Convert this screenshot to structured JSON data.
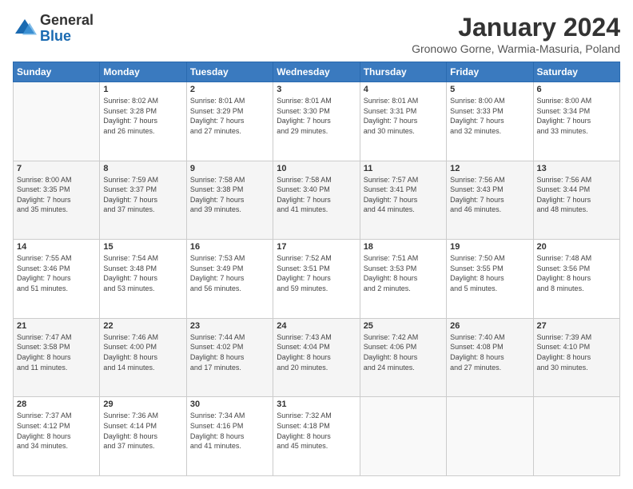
{
  "logo": {
    "general": "General",
    "blue": "Blue"
  },
  "title": "January 2024",
  "subtitle": "Gronowo Gorne, Warmia-Masuria, Poland",
  "weekdays": [
    "Sunday",
    "Monday",
    "Tuesday",
    "Wednesday",
    "Thursday",
    "Friday",
    "Saturday"
  ],
  "weeks": [
    [
      {
        "day": "",
        "info": ""
      },
      {
        "day": "1",
        "info": "Sunrise: 8:02 AM\nSunset: 3:28 PM\nDaylight: 7 hours\nand 26 minutes."
      },
      {
        "day": "2",
        "info": "Sunrise: 8:01 AM\nSunset: 3:29 PM\nDaylight: 7 hours\nand 27 minutes."
      },
      {
        "day": "3",
        "info": "Sunrise: 8:01 AM\nSunset: 3:30 PM\nDaylight: 7 hours\nand 29 minutes."
      },
      {
        "day": "4",
        "info": "Sunrise: 8:01 AM\nSunset: 3:31 PM\nDaylight: 7 hours\nand 30 minutes."
      },
      {
        "day": "5",
        "info": "Sunrise: 8:00 AM\nSunset: 3:33 PM\nDaylight: 7 hours\nand 32 minutes."
      },
      {
        "day": "6",
        "info": "Sunrise: 8:00 AM\nSunset: 3:34 PM\nDaylight: 7 hours\nand 33 minutes."
      }
    ],
    [
      {
        "day": "7",
        "info": "Sunrise: 8:00 AM\nSunset: 3:35 PM\nDaylight: 7 hours\nand 35 minutes."
      },
      {
        "day": "8",
        "info": "Sunrise: 7:59 AM\nSunset: 3:37 PM\nDaylight: 7 hours\nand 37 minutes."
      },
      {
        "day": "9",
        "info": "Sunrise: 7:58 AM\nSunset: 3:38 PM\nDaylight: 7 hours\nand 39 minutes."
      },
      {
        "day": "10",
        "info": "Sunrise: 7:58 AM\nSunset: 3:40 PM\nDaylight: 7 hours\nand 41 minutes."
      },
      {
        "day": "11",
        "info": "Sunrise: 7:57 AM\nSunset: 3:41 PM\nDaylight: 7 hours\nand 44 minutes."
      },
      {
        "day": "12",
        "info": "Sunrise: 7:56 AM\nSunset: 3:43 PM\nDaylight: 7 hours\nand 46 minutes."
      },
      {
        "day": "13",
        "info": "Sunrise: 7:56 AM\nSunset: 3:44 PM\nDaylight: 7 hours\nand 48 minutes."
      }
    ],
    [
      {
        "day": "14",
        "info": "Sunrise: 7:55 AM\nSunset: 3:46 PM\nDaylight: 7 hours\nand 51 minutes."
      },
      {
        "day": "15",
        "info": "Sunrise: 7:54 AM\nSunset: 3:48 PM\nDaylight: 7 hours\nand 53 minutes."
      },
      {
        "day": "16",
        "info": "Sunrise: 7:53 AM\nSunset: 3:49 PM\nDaylight: 7 hours\nand 56 minutes."
      },
      {
        "day": "17",
        "info": "Sunrise: 7:52 AM\nSunset: 3:51 PM\nDaylight: 7 hours\nand 59 minutes."
      },
      {
        "day": "18",
        "info": "Sunrise: 7:51 AM\nSunset: 3:53 PM\nDaylight: 8 hours\nand 2 minutes."
      },
      {
        "day": "19",
        "info": "Sunrise: 7:50 AM\nSunset: 3:55 PM\nDaylight: 8 hours\nand 5 minutes."
      },
      {
        "day": "20",
        "info": "Sunrise: 7:48 AM\nSunset: 3:56 PM\nDaylight: 8 hours\nand 8 minutes."
      }
    ],
    [
      {
        "day": "21",
        "info": "Sunrise: 7:47 AM\nSunset: 3:58 PM\nDaylight: 8 hours\nand 11 minutes."
      },
      {
        "day": "22",
        "info": "Sunrise: 7:46 AM\nSunset: 4:00 PM\nDaylight: 8 hours\nand 14 minutes."
      },
      {
        "day": "23",
        "info": "Sunrise: 7:44 AM\nSunset: 4:02 PM\nDaylight: 8 hours\nand 17 minutes."
      },
      {
        "day": "24",
        "info": "Sunrise: 7:43 AM\nSunset: 4:04 PM\nDaylight: 8 hours\nand 20 minutes."
      },
      {
        "day": "25",
        "info": "Sunrise: 7:42 AM\nSunset: 4:06 PM\nDaylight: 8 hours\nand 24 minutes."
      },
      {
        "day": "26",
        "info": "Sunrise: 7:40 AM\nSunset: 4:08 PM\nDaylight: 8 hours\nand 27 minutes."
      },
      {
        "day": "27",
        "info": "Sunrise: 7:39 AM\nSunset: 4:10 PM\nDaylight: 8 hours\nand 30 minutes."
      }
    ],
    [
      {
        "day": "28",
        "info": "Sunrise: 7:37 AM\nSunset: 4:12 PM\nDaylight: 8 hours\nand 34 minutes."
      },
      {
        "day": "29",
        "info": "Sunrise: 7:36 AM\nSunset: 4:14 PM\nDaylight: 8 hours\nand 37 minutes."
      },
      {
        "day": "30",
        "info": "Sunrise: 7:34 AM\nSunset: 4:16 PM\nDaylight: 8 hours\nand 41 minutes."
      },
      {
        "day": "31",
        "info": "Sunrise: 7:32 AM\nSunset: 4:18 PM\nDaylight: 8 hours\nand 45 minutes."
      },
      {
        "day": "",
        "info": ""
      },
      {
        "day": "",
        "info": ""
      },
      {
        "day": "",
        "info": ""
      }
    ]
  ]
}
